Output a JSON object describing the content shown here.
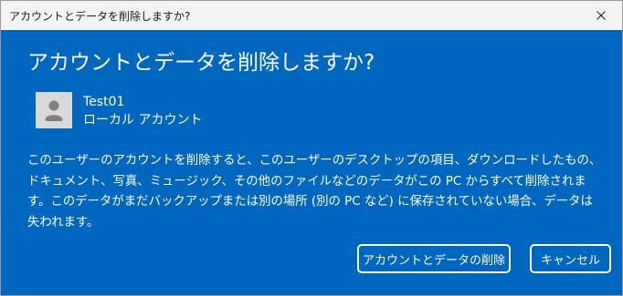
{
  "window": {
    "title": "アカウントとデータを削除しますか?"
  },
  "dialog": {
    "heading": "アカウントとデータを削除しますか?",
    "account": {
      "name": "Test01",
      "type": "ローカル アカウント"
    },
    "description": "このユーザーのアカウントを削除すると、このユーザーのデスクトップの項目、ダウンロードしたもの、ドキュメント、写真、ミュージック、その他のファイルなどのデータがこの PC からすべて削除されます。このデータがまだバックアップまたは別の場所 (別の PC など) に保存されていない場合、データは失われます。",
    "buttons": {
      "delete_label": "アカウントとデータの削除",
      "cancel_label": "キャンセル"
    }
  },
  "icons": {
    "close": "close-icon",
    "avatar": "user-avatar-icon"
  },
  "colors": {
    "dialog_background": "#0067c0",
    "titlebar_background": "#f3f3f3",
    "text": "#ffffff"
  }
}
